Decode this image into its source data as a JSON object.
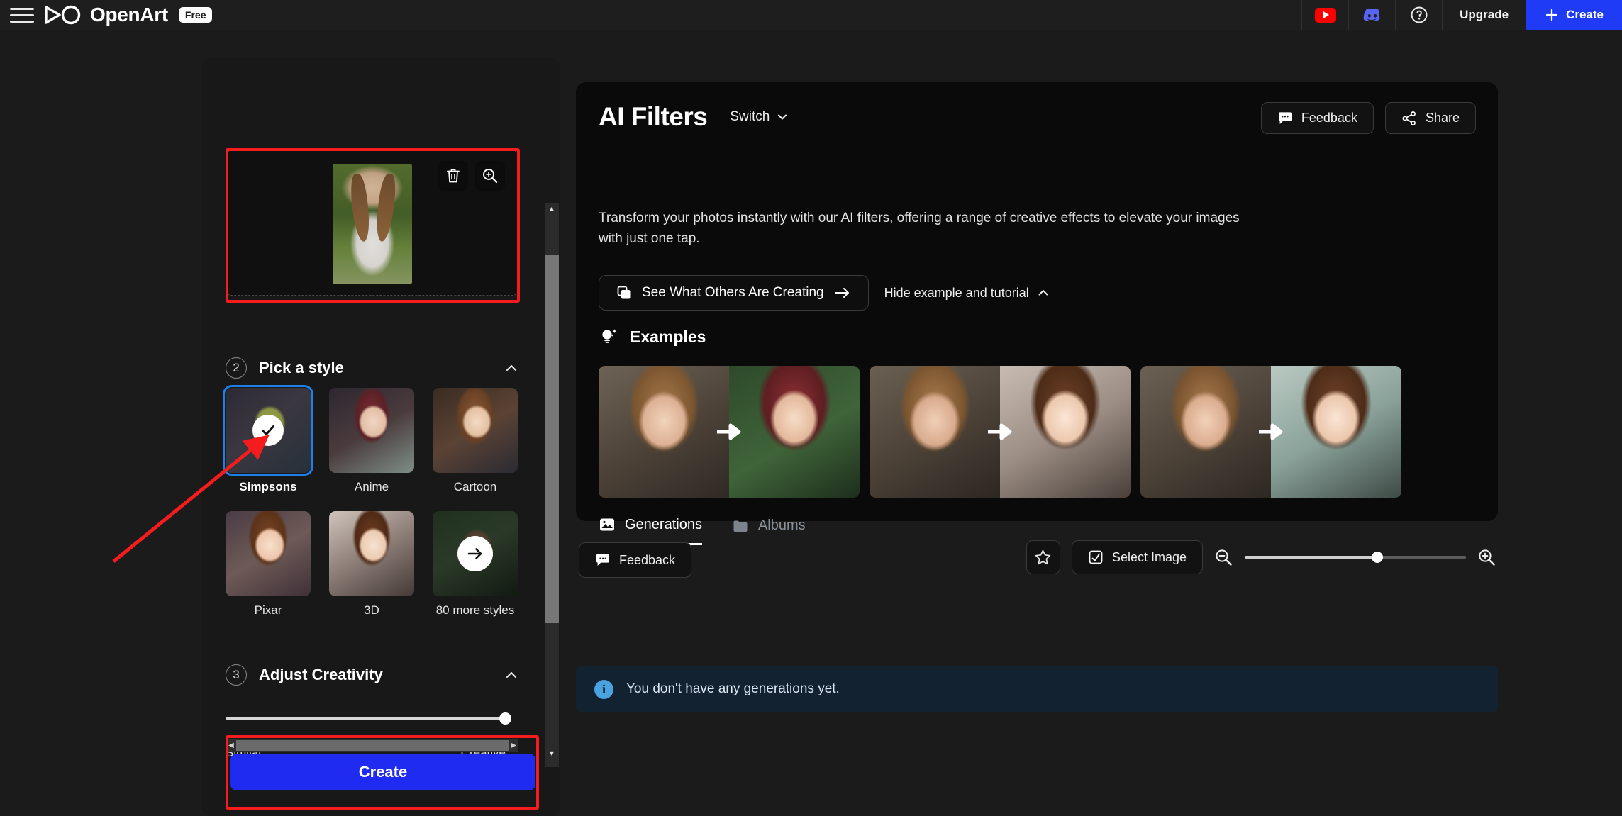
{
  "topbar": {
    "menu_icon": "hamburger-icon",
    "brand": "OpenArt",
    "plan_badge": "Free",
    "youtube_icon": "youtube-icon",
    "discord_icon": "discord-icon",
    "help_icon": "question-circle-icon",
    "upgrade_label": "Upgrade",
    "create_label": "Create",
    "create_plus": "+"
  },
  "sidebar": {
    "image_actions": {
      "delete_icon": "trash-icon",
      "zoom_icon": "magnifier-plus-icon"
    },
    "style_section": {
      "step": "2",
      "title": "Pick a style",
      "collapse_icon": "chevron-up-icon",
      "styles": [
        {
          "label": "Simpsons",
          "selected": true,
          "badge": "check-icon"
        },
        {
          "label": "Anime",
          "selected": false,
          "badge": ""
        },
        {
          "label": "Cartoon",
          "selected": false,
          "badge": ""
        },
        {
          "label": "Pixar",
          "selected": false,
          "badge": ""
        },
        {
          "label": "3D",
          "selected": false,
          "badge": ""
        },
        {
          "label": "80 more styles",
          "selected": false,
          "badge": "arrow-right-icon"
        }
      ]
    },
    "creativity_section": {
      "step": "3",
      "title": "Adjust Creativity",
      "collapse_icon": "chevron-up-icon",
      "min_label": "Similar",
      "max_label": "Creative",
      "value_percent": 100
    },
    "create_button": "Create",
    "hscroll": {
      "left_arrow": "◀",
      "right_arrow": "▶"
    },
    "vscroll": {
      "up_arrow": "▲",
      "down_arrow": "▼"
    }
  },
  "main": {
    "title": "AI Filters",
    "switch_label": "Switch",
    "switch_icon": "chevron-down-icon",
    "feedback_label": "Feedback",
    "feedback_icon": "chat-bubble-icon",
    "share_label": "Share",
    "share_icon": "share-nodes-icon",
    "description": "Transform your photos instantly with our AI filters, offering a range of creative effects to elevate your images with just one tap.",
    "see_others_label": "See What Others Are Creating",
    "see_others_icon": "copy-stack-icon",
    "see_others_arrow": "arrow-right-icon",
    "hide_tutorial_label": "Hide example and tutorial",
    "hide_tutorial_icon": "chevron-up-icon",
    "examples_title": "Examples",
    "examples_icon": "lightbulb-sparkle-icon",
    "example_pairs": [
      {
        "before": "girl-photo-pink-flower",
        "after": "anime-christmas-green-hair",
        "arrow": "arrow-right-icon"
      },
      {
        "before": "girl-photo-orange-hair",
        "after": "anime-pale-portrait",
        "arrow": "arrow-right-icon"
      },
      {
        "before": "girl-photo-pink-flower-2",
        "after": "anime-teal-background",
        "arrow": "arrow-right-icon"
      }
    ],
    "tabs": [
      {
        "label": "Generations",
        "icon": "image-icon",
        "active": true
      },
      {
        "label": "Albums",
        "icon": "folder-icon",
        "active": false
      }
    ]
  },
  "toolbar": {
    "feedback_label": "Feedback",
    "feedback_icon": "chat-bubble-icon",
    "favorite_icon": "star-icon",
    "select_image_label": "Select Image",
    "select_image_icon": "select-square-icon",
    "zoom_out_icon": "magnifier-minus-icon",
    "zoom_in_icon": "magnifier-plus-icon",
    "zoom_value_percent": 60
  },
  "status": {
    "info_icon": "info-circle-icon",
    "info_letter": "i",
    "message": "You don't have any generations yet."
  },
  "annotations": {
    "upload_box_color": "#f41c1c",
    "create_box_color": "#f41c1c",
    "arrow_color": "#f41c1c"
  }
}
